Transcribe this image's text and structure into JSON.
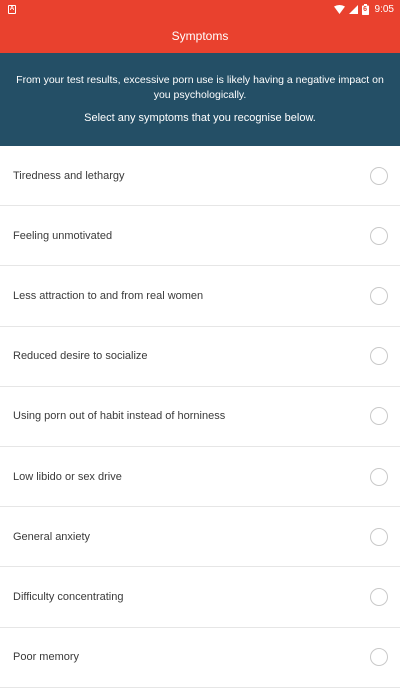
{
  "status_bar": {
    "notification_icon_glyph": "A",
    "time": "9:05",
    "battery_level_text": "6"
  },
  "app_bar": {
    "title": "Symptoms"
  },
  "intro": {
    "message": "From your test results, excessive porn use is likely having a negative impact on you psychologically.",
    "instruction": "Select any symptoms that you recognise below."
  },
  "symptoms": [
    {
      "label": "Tiredness and lethargy",
      "selected": false
    },
    {
      "label": "Feeling unmotivated",
      "selected": false
    },
    {
      "label": "Less attraction to and from real women",
      "selected": false
    },
    {
      "label": "Reduced desire to socialize",
      "selected": false
    },
    {
      "label": "Using porn out of habit instead of horniness",
      "selected": false
    },
    {
      "label": "Low libido or sex drive",
      "selected": false
    },
    {
      "label": "General anxiety",
      "selected": false
    },
    {
      "label": "Difficulty concentrating",
      "selected": false
    },
    {
      "label": "Poor memory",
      "selected": false
    }
  ],
  "colors": {
    "app_bar": "#e9412e",
    "intro_background": "#244f66",
    "divider": "#e6e6e6",
    "radio_border": "#c9c9c9"
  }
}
